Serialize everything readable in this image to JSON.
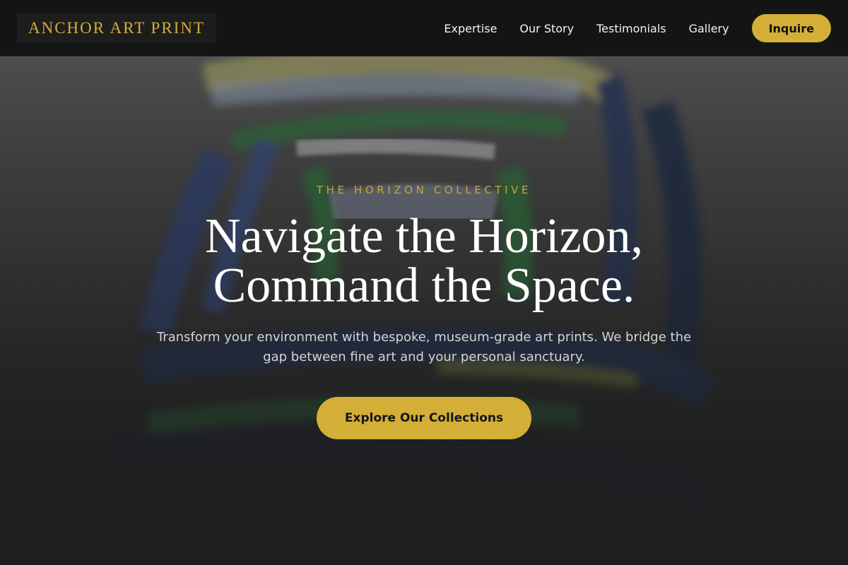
{
  "brand": {
    "name": "ANCHOR ART PRINT",
    "accent_color": "#d4af37"
  },
  "nav": {
    "links": [
      "Expertise",
      "Our Story",
      "Testimonials",
      "Gallery"
    ],
    "cta_label": "Inquire"
  },
  "hero": {
    "image_alt": "abstract painted artwork background",
    "eyebrow": "THE HORIZON COLLECTIVE",
    "headline_line1": "Navigate the Horizon,",
    "headline_line2": "Command the Space.",
    "subtext_line1": "Transform your environment with bespoke, museum-grade art prints. We bridge the",
    "subtext_line2": "gap between fine art and your personal sanctuary.",
    "cta_label": "Explore Our Collections"
  }
}
